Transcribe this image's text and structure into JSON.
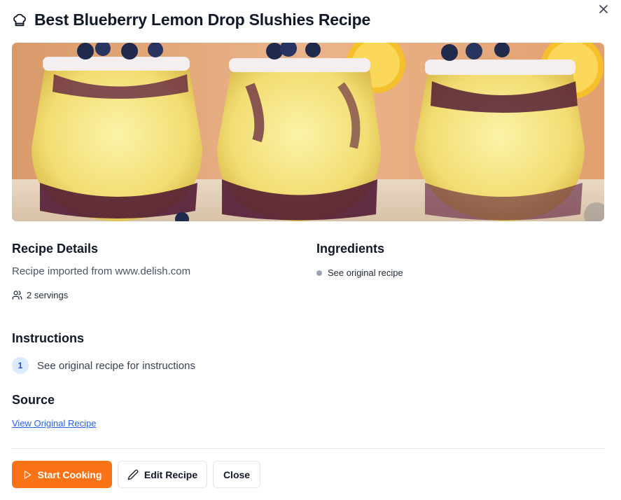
{
  "dialog": {
    "title": "Best Blueberry Lemon Drop Slushies Recipe",
    "title_icon": "chef-hat-icon",
    "close_icon": "close-icon"
  },
  "hero_image": {
    "subject": "three glasses of blueberry lemon slush with sugared rims, blueberries and lemon slices"
  },
  "details": {
    "heading": "Recipe Details",
    "description": "Recipe imported from www.delish.com",
    "servings": "2 servings",
    "servings_icon": "users-icon"
  },
  "ingredients": {
    "heading": "Ingredients",
    "items": [
      "See original recipe"
    ]
  },
  "instructions": {
    "heading": "Instructions",
    "steps": [
      {
        "number": "1",
        "text": "See original recipe for instructions"
      }
    ]
  },
  "source": {
    "heading": "Source",
    "link_label": "View Original Recipe"
  },
  "footer": {
    "start_label": "Start Cooking",
    "start_icon": "play-icon",
    "edit_label": "Edit Recipe",
    "edit_icon": "pencil-icon",
    "close_label": "Close"
  },
  "colors": {
    "accent": "#f97316",
    "link": "#2563eb",
    "step_badge_bg": "#dbeafe",
    "step_badge_text": "#1d4ed8",
    "divider": "#e5e7eb"
  }
}
